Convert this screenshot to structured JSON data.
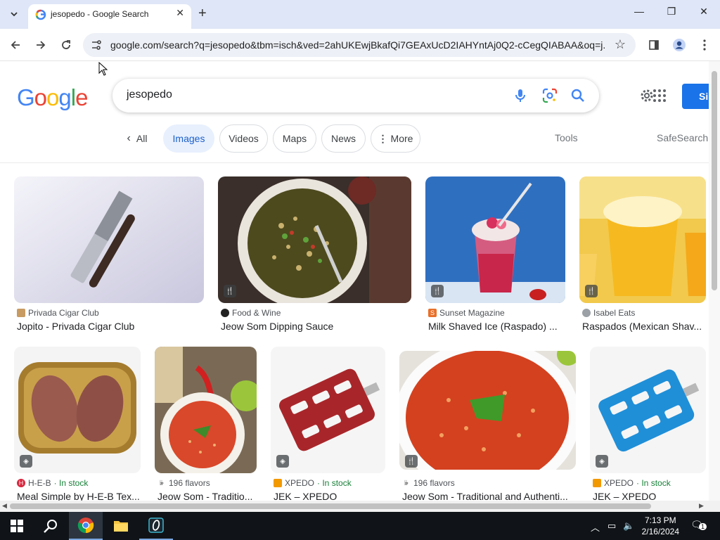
{
  "browser": {
    "tab_title": "jesopedo - Google Search",
    "url": "google.com/search?q=jesopedo&tbm=isch&ved=2ahUKEwjBkafQi7GEAxUcD2IAHYntAj0Q2-cCegQIABAA&oq=j..."
  },
  "google": {
    "logo_text": "Google",
    "query": "jesopedo",
    "signin_label": "Si",
    "filters": {
      "all": "All",
      "images": "Images",
      "videos": "Videos",
      "maps": "Maps",
      "news": "News",
      "more": "More",
      "tools": "Tools",
      "safesearch": "SafeSearch"
    }
  },
  "results": [
    {
      "source": "Privada Cigar Club",
      "title": "Jopito - Privada Cigar Club",
      "in_stock": ""
    },
    {
      "source": "Food & Wine",
      "title": "Jeow Som Dipping Sauce",
      "in_stock": ""
    },
    {
      "source": "Sunset Magazine",
      "title": "Milk Shaved Ice (Raspado) ...",
      "in_stock": ""
    },
    {
      "source": "Isabel Eats",
      "title": "Raspados (Mexican Shav...",
      "in_stock": ""
    },
    {
      "source": "H-E-B",
      "title": "Meal Simple by H-E-B Tex...",
      "in_stock": "· In stock"
    },
    {
      "source": "196 flavors",
      "title": "Jeow Som - Traditio...",
      "in_stock": ""
    },
    {
      "source": "XPEDO",
      "title": "JEK – XPEDO",
      "in_stock": "· In stock"
    },
    {
      "source": "196 flavors",
      "title": "Jeow Som - Traditional and Authenti...",
      "in_stock": ""
    },
    {
      "source": "XPEDO",
      "title": "JEK – XPEDO",
      "in_stock": "· In stock"
    }
  ],
  "taskbar": {
    "time": "7:13 PM",
    "date": "2/16/2024",
    "notification_count": "1"
  },
  "colors": {
    "accent": "#1a73e8",
    "active_chip_bg": "#e8f0fe",
    "in_stock": "#188038",
    "tabstrip": "#dee6f7"
  }
}
